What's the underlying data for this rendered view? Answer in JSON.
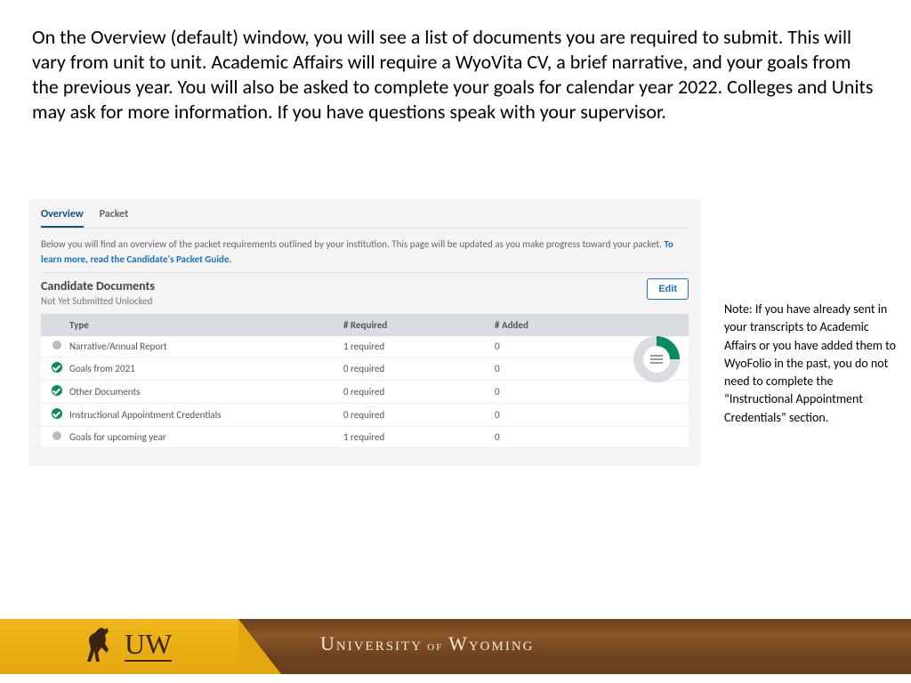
{
  "main_text": "On the Overview (default) window, you will see a list of documents you are required to submit. This will vary from unit to unit. Academic Affairs will require a WyoVita CV, a brief narrative, and your goals from the previous year. You will also be asked to complete your goals for calendar year 2022. Colleges and Units may ask for more information. If you have questions speak with your supervisor.",
  "tabs": {
    "overview": "Overview",
    "packet": "Packet"
  },
  "instruction_prefix": "Below you will find an overview of the packet requirements outlined by your institution. This page will be updated as you make progress toward your packet. ",
  "instruction_link": "To learn more, read the Candidate's Packet Guide.",
  "section_title": "Candidate Documents",
  "section_sub": "Not Yet Submitted Unlocked",
  "edit": "Edit",
  "headers": {
    "type": "Type",
    "required": "# Required",
    "added": "# Added"
  },
  "rows": [
    {
      "icon": "gray",
      "type": "Narrative/Annual Report",
      "req": "1 required",
      "add": "0"
    },
    {
      "icon": "green",
      "type": "Goals from 2021",
      "req": "0 required",
      "add": "0"
    },
    {
      "icon": "green",
      "type": "Other Documents",
      "req": "0 required",
      "add": "0"
    },
    {
      "icon": "green",
      "type": "Instructional Appointment Credentials",
      "req": "0 required",
      "add": "0"
    },
    {
      "icon": "gray",
      "type": "Goals for upcoming year",
      "req": "1 required",
      "add": "0"
    }
  ],
  "note": "Note: If you have already sent in your transcripts to Academic Affairs or you have added them to WyoFolio in the past, you do not need to complete the “Instructional Appointment Credentials” section.",
  "footer": {
    "uw": "UW",
    "univ_1": "U",
    "univ_2": "NIVERSITY",
    "univ_of": " of ",
    "univ_3": "W",
    "univ_4": "YOMING"
  }
}
